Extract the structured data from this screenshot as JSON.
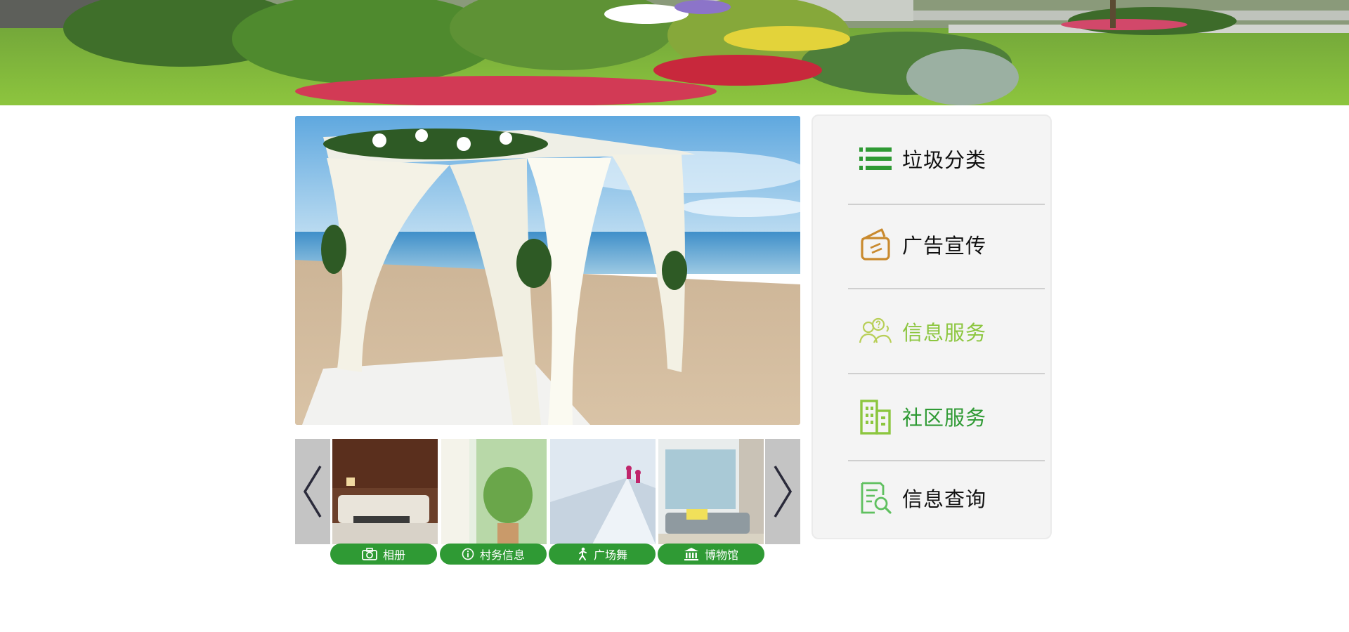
{
  "menu": {
    "items": [
      {
        "label": "垃圾分类",
        "icon": "list-icon",
        "color": "#111111",
        "icon_color": "#2f9a34"
      },
      {
        "label": "广告宣传",
        "icon": "card-icon",
        "color": "#111111",
        "icon_color": "#c98a2e"
      },
      {
        "label": "信息服务",
        "icon": "people-question-icon",
        "color": "#8cc63f",
        "icon_color": "#b8cf57"
      },
      {
        "label": "社区服务",
        "icon": "building-icon",
        "color": "#2f9a34",
        "icon_color": "#8cc63f"
      },
      {
        "label": "信息查询",
        "icon": "document-search-icon",
        "color": "#111111",
        "icon_color": "#5fc05f"
      }
    ]
  },
  "thumbnails": [
    {
      "label": "相册",
      "icon": "camera-icon"
    },
    {
      "label": "村务信息",
      "icon": "info-icon"
    },
    {
      "label": "广场舞",
      "icon": "dancer-icon"
    },
    {
      "label": "博物馆",
      "icon": "museum-icon"
    }
  ],
  "colors": {
    "accent_green": "#2f9a34",
    "light_green": "#8cc63f",
    "arrow_bg": "#c4c4c4",
    "panel_bg": "#f4f4f4"
  }
}
